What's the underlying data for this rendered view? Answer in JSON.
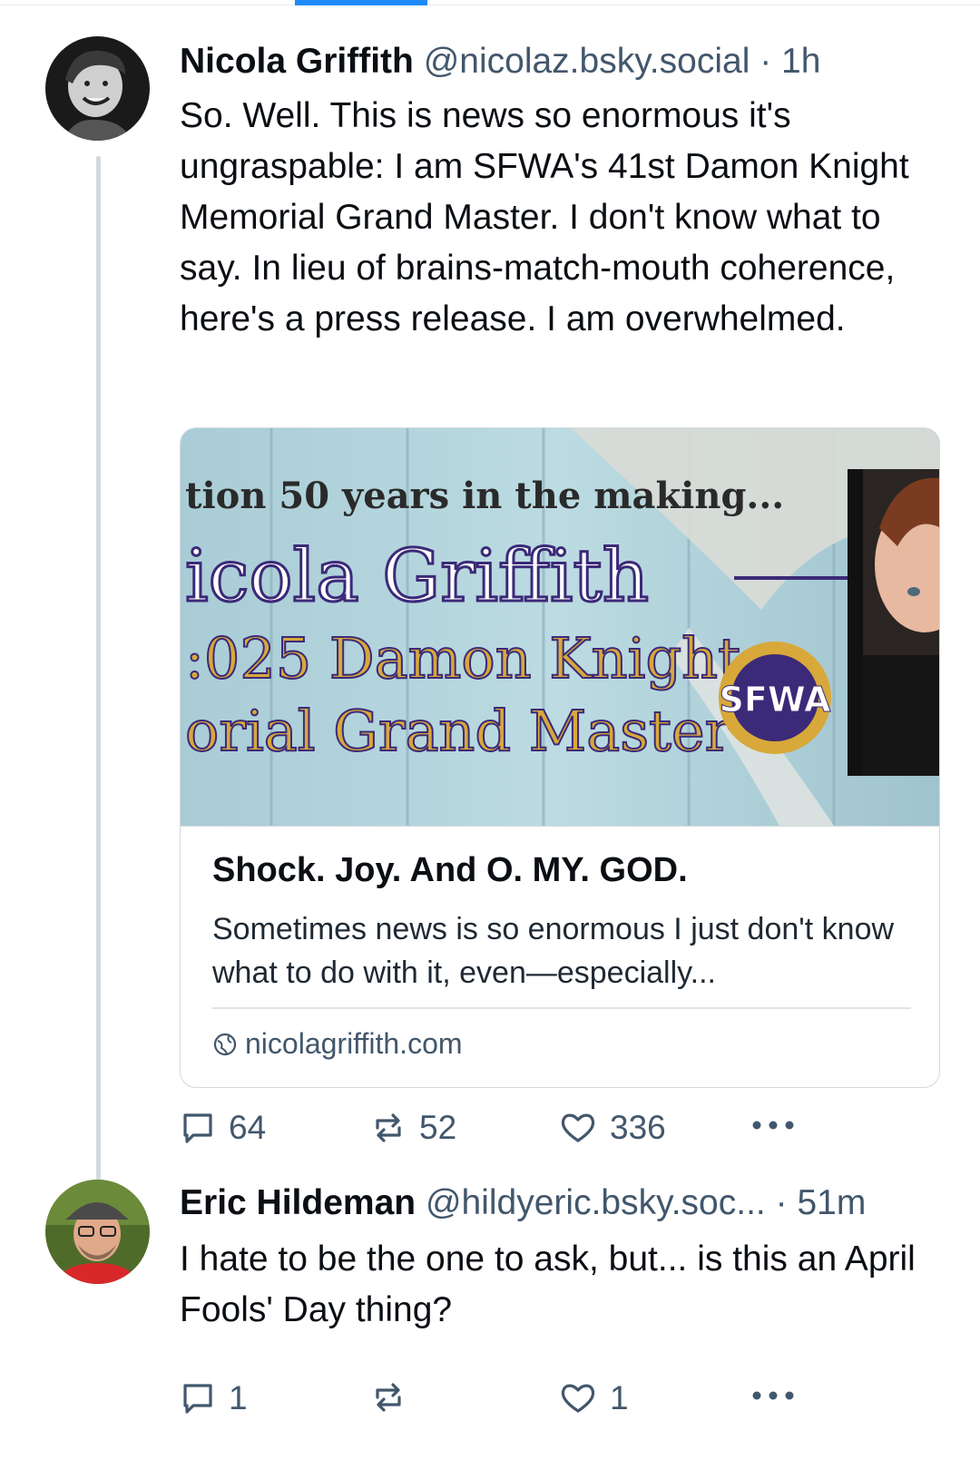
{
  "posts": [
    {
      "author_name": "Nicola Griffith",
      "handle": "@nicolaz.bsky.social",
      "separator": "·",
      "time": "1h",
      "text": "So. Well. This is news so enormous it's ungraspable: I am SFWA's 41st Damon Knight Memorial Grand Master. I don't know what to say. In lieu of brains-match-mouth coherence, here's a press release. I am overwhelmed.",
      "link_card": {
        "image_text_line1": "tion 50 years in the making...",
        "image_text_line2": "icola Griffith",
        "image_text_line3": ":025 Damon Knight",
        "image_text_line4": "orial Grand Master",
        "logo_text": "SFWA",
        "title": "Shock. Joy. And O. MY. GOD.",
        "description": "Sometimes news is so enormous I just don't know what to do with it, even—especially...",
        "domain": "nicolagriffith.com"
      },
      "replies": "64",
      "reposts": "52",
      "likes": "336"
    },
    {
      "author_name": "Eric Hildeman",
      "handle": "@hildyeric.bsky.soc...",
      "separator": "·",
      "time": "51m",
      "text": "I hate to be the one to ask, but... is this an April Fools' Day thing?",
      "replies": "1",
      "reposts": "",
      "likes": "1"
    }
  ],
  "icons": {
    "reply": "speech-bubble-icon",
    "repost": "repost-arrows-icon",
    "like": "heart-icon",
    "more": "ellipsis-icon",
    "globe": "globe-icon"
  },
  "colors": {
    "accent": "#1d8cf8",
    "muted_text": "#42576c",
    "thread_line": "#d4d9df",
    "banner_purple": "#3b2a78",
    "banner_gold": "#d8a83a"
  }
}
